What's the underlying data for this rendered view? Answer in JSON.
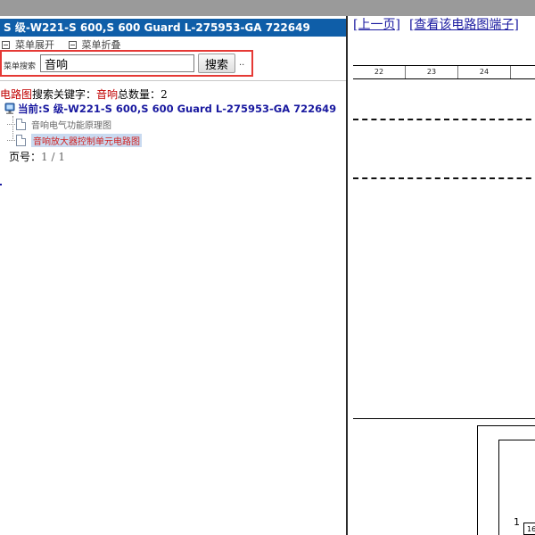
{
  "window": {
    "title": "S 级-W221-S 600,S 600 Guard L-275953-GA 722649"
  },
  "menu": {
    "expand_label": "菜单展开",
    "collapse_label": "菜单折叠"
  },
  "search": {
    "label": "菜单搜索",
    "value": "音响",
    "button_label": "搜索",
    "more_label": ".."
  },
  "results": {
    "category": "电路图",
    "keyword_label": "搜索关键字：",
    "keyword": "音响",
    "count_label": "总数量：",
    "count": "2",
    "current_label": "当前:S 级-W221-S 600,S 600 Guard L-275953-GA 722649",
    "items": [
      {
        "label": "音响电气功能原理图",
        "active": false
      },
      {
        "label": "音响放大器控制单元电路图",
        "active": true
      }
    ],
    "page_label": "页号：",
    "page_value": "1 / 1"
  },
  "nav": {
    "prev_label": "[上一页]",
    "terminal_label": "[查看该电路图端子]"
  },
  "diagram": {
    "ruler_numbers": [
      "22",
      "23",
      "24"
    ],
    "pin_label": "1",
    "pin_box_label": "16"
  },
  "colors": {
    "title_bar": "#0f5ea8",
    "highlight_border": "#e53935",
    "link": "#1a1aa0",
    "accent_red": "#c00000",
    "active_item_bg": "#c9daf0"
  },
  "icons": {
    "tree_root": "computer-icon",
    "tree_item": "document-icon",
    "menu": "square-icon"
  }
}
